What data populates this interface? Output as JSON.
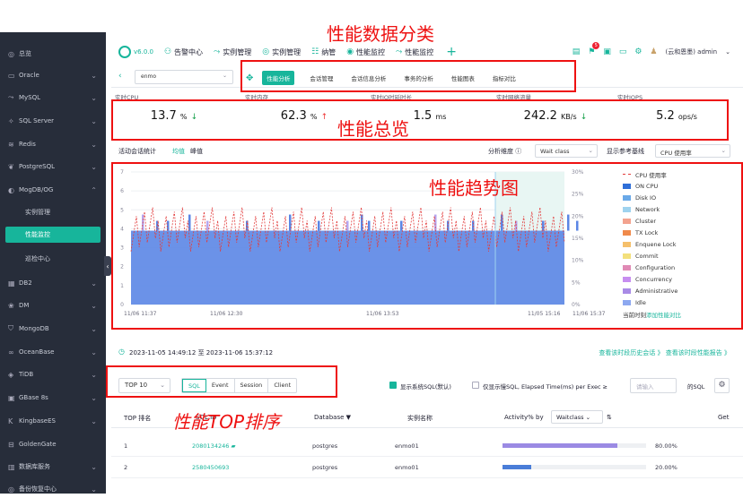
{
  "annotations": {
    "category": "性能数据分类",
    "overview": "性能总览",
    "trend": "性能趋势图",
    "top": "性能TOP排序"
  },
  "sidebar": {
    "items": [
      {
        "label": "总览",
        "icon": "dashboard-icon"
      },
      {
        "label": "Oracle",
        "icon": "oracle-icon"
      },
      {
        "label": "MySQL",
        "icon": "mysql-icon"
      },
      {
        "label": "SQL Server",
        "icon": "sqlserver-icon"
      },
      {
        "label": "Redis",
        "icon": "redis-icon"
      },
      {
        "label": "PostgreSQL",
        "icon": "postgresql-icon"
      },
      {
        "label": "MogDB/OG",
        "icon": "mogdb-icon"
      },
      {
        "label": "DB2",
        "icon": "db2-icon"
      },
      {
        "label": "DM",
        "icon": "dm-icon"
      },
      {
        "label": "MongoDB",
        "icon": "mongodb-icon"
      },
      {
        "label": "OceanBase",
        "icon": "oceanbase-icon"
      },
      {
        "label": "TiDB",
        "icon": "tidb-icon"
      },
      {
        "label": "GBase 8s",
        "icon": "gbase-icon"
      },
      {
        "label": "KingbaseES",
        "icon": "kingbase-icon"
      },
      {
        "label": "GoldenGate",
        "icon": "goldengate-icon"
      },
      {
        "label": "数据库服务",
        "icon": "db-service-icon"
      },
      {
        "label": "备份恢复中心",
        "icon": "backup-icon"
      }
    ],
    "sub_items": [
      "实例管理",
      "性能监控",
      "巡检中心"
    ]
  },
  "topbar": {
    "version": "v6.0.0",
    "nav": [
      {
        "label": "告警中心",
        "icon": "alarm-icon"
      },
      {
        "label": "实例管理",
        "icon": "instance-icon"
      },
      {
        "label": "实例管理",
        "icon": "instance2-icon"
      },
      {
        "label": "纳管",
        "icon": "manage-icon"
      },
      {
        "label": "性能监控",
        "icon": "monitor-icon"
      },
      {
        "label": "性能监控",
        "icon": "monitor2-icon"
      }
    ],
    "notification_count": "5",
    "user": "(云和恩墨) admin"
  },
  "subbar": {
    "db_value": "enmo",
    "tabs": [
      "性能分析",
      "会话管理",
      "会话信息分析",
      "事务的分析",
      "性能图表",
      "指标对比"
    ]
  },
  "metrics": [
    {
      "label": "实时CPU",
      "value": "13.7",
      "unit": "%",
      "trend": "down"
    },
    {
      "label": "实时内存",
      "value": "62.3",
      "unit": "%",
      "trend": "up"
    },
    {
      "label": "实时IO时延时长",
      "value": "1.5",
      "unit": "ms",
      "trend": ""
    },
    {
      "label": "实时网络流量",
      "value": "242.2",
      "unit": "KB/s",
      "trend": "down"
    },
    {
      "label": "实时IOPS",
      "value": "5.2",
      "unit": "ops/s",
      "trend": ""
    }
  ],
  "controls": {
    "stats_label": "活动会话统计",
    "avg": "均值",
    "peak": "峰值",
    "dimension_label": "分析维度",
    "dimension_value": "Wait class",
    "ref_label": "显示参考基线",
    "ref_value": "CPU 使用率"
  },
  "chart_data": {
    "type": "area",
    "x_ticks": [
      "11/06 11:37",
      "11/06 12:30",
      "11/06 13:53",
      "11/05 15:16",
      "11/06 15:37"
    ],
    "y_ticks": [
      "0",
      "1",
      "2",
      "3",
      "4",
      "5",
      "6",
      "7"
    ],
    "y2_ticks": [
      "0%",
      "5%",
      "10%",
      "15%",
      "20%",
      "25%",
      "30%"
    ],
    "ylim": [
      0,
      7
    ],
    "baseline_idle": 3.9,
    "cpu_line_pct_range": [
      12,
      22
    ],
    "legend": [
      {
        "name": "CPU 使用率",
        "color": "#e23b3b"
      },
      {
        "name": "ON CPU",
        "color": "#2f6fd8"
      },
      {
        "name": "Disk IO",
        "color": "#6aa9e8"
      },
      {
        "name": "Network",
        "color": "#9fd3ef"
      },
      {
        "name": "Cluster",
        "color": "#f3a38f"
      },
      {
        "name": "TX Lock",
        "color": "#f08a4b"
      },
      {
        "name": "Enquene Lock",
        "color": "#f5c06b"
      },
      {
        "name": "Commit",
        "color": "#f3e07c"
      },
      {
        "name": "Configuration",
        "color": "#e08ab5"
      },
      {
        "name": "Concurrency",
        "color": "#c78ef0"
      },
      {
        "name": "Administrative",
        "color": "#a98be6"
      },
      {
        "name": "Idle",
        "color": "#8da8f0"
      }
    ],
    "legend_footer": "当前时刻",
    "legend_link": "添加性能对比"
  },
  "range": {
    "text": "2023-11-05 14:49:12 至 2023-11-06 15:37:12",
    "links": "查看该时段历史会话 》 查看该时段性能报告 》"
  },
  "top_controls": {
    "top_value": "TOP 10",
    "segments": [
      "SQL",
      "Event",
      "Session",
      "Client"
    ],
    "check1": "显示系统SQL(默认)",
    "check2": "仅显示慢SQL, Elapsed Time(ms) per Exec ≥",
    "input_placeholder": "请输入",
    "suffix": "的SQL"
  },
  "table": {
    "headers": [
      "TOP 排名",
      "SQL ID",
      "Database",
      "实例名称",
      "Activity% by",
      "Get"
    ],
    "activity_by": "Waitclass",
    "rows": [
      {
        "rank": "1",
        "sql_id": "2080134246",
        "db": "postgres",
        "inst": "enmo01",
        "pct": "80.00%",
        "value": 0.8
      },
      {
        "rank": "2",
        "sql_id": "2580450693",
        "db": "postgres",
        "inst": "enmo01",
        "pct": "20.00%",
        "value": 0.2
      }
    ]
  }
}
